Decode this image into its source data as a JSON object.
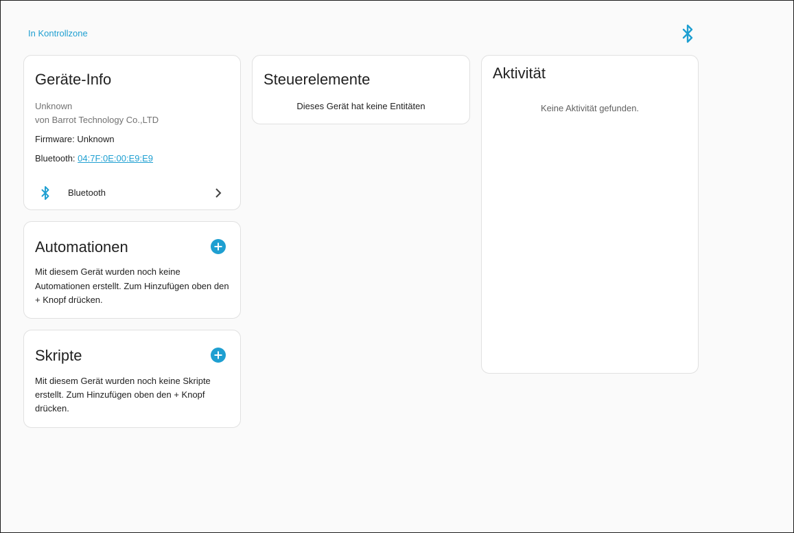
{
  "header": {
    "area_link": "In Kontrollzone",
    "icon": "bluetooth-icon"
  },
  "device_info": {
    "title": "Geräte-Info",
    "model": "Unknown",
    "manufacturer": "von Barrot Technology Co.,LTD",
    "firmware": "Firmware: Unknown",
    "bluetooth_label": "Bluetooth: ",
    "bluetooth_address": "04:7F:0E:00:E9:E9",
    "integration": {
      "icon": "bluetooth-icon",
      "label": "Bluetooth",
      "chevron": "chevron-right-icon"
    }
  },
  "controls": {
    "title": "Steuerelemente",
    "empty_text": "Dieses Gerät hat keine Entitäten"
  },
  "activity": {
    "title": "Aktivität",
    "empty_text": "Keine Aktivität gefunden."
  },
  "automations": {
    "title": "Automationen",
    "text": "Mit diesem Gerät wurden noch keine Automationen erstellt. Zum Hinzufügen oben den + Knopf drücken.",
    "add_icon": "plus-circle-icon"
  },
  "scripts": {
    "title": "Skripte",
    "text": "Mit diesem Gerät wurden noch keine Skripte erstellt. Zum Hinzufügen oben den + Knopf drücken.",
    "add_icon": "plus-circle-icon"
  },
  "colors": {
    "accent": "#1e9fd1",
    "background": "#fafafa",
    "card": "#ffffff"
  }
}
